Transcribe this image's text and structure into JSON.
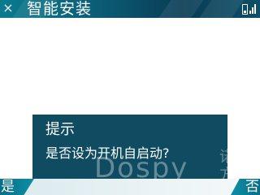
{
  "header": {
    "title": "智能安装",
    "close_icon": "close-icon",
    "battery_icon": "battery-icon",
    "signal_icon": "signal-icon"
  },
  "dialog": {
    "title": "提示",
    "message": "是否设为开机自启动?"
  },
  "watermark": {
    "text": "Dospy",
    "cn_text": "诺亚方舟"
  },
  "softkeys": {
    "left": "是",
    "right": "否"
  },
  "colors": {
    "bar_teal": "#0b5f78",
    "dialog_bg": "#0f4c62",
    "text": "#ffffff",
    "background": "#ffffff"
  }
}
